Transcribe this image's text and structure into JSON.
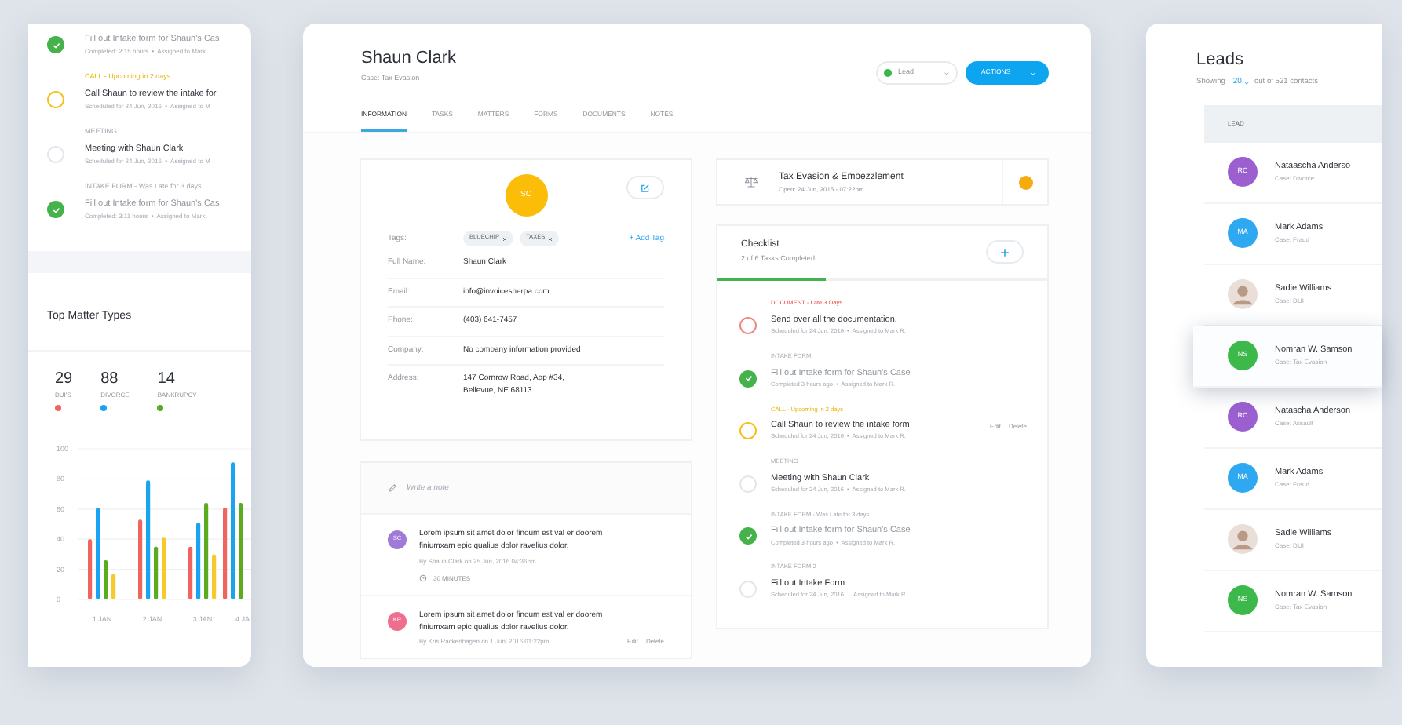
{
  "side_tasks": [
    {
      "checked": true,
      "title": "Fill out Intake form for Shaun's Cas",
      "meta": "Completed: 2:15 hours  •  Assigned to Mark"
    },
    {
      "kind": "upcoming",
      "checked": false,
      "label": "CALL - Upcoming in 2 days",
      "title": "Call Shaun to review the intake for",
      "meta": "Scheduled for 24 Jun, 2016  •  Assigned to M"
    },
    {
      "kind": "normal",
      "checked": false,
      "label": "MEETING",
      "title": "Meeting with Shaun Clark",
      "meta": "Scheduled for 24 Jun, 2016  •  Assigned to M"
    },
    {
      "kind": "normal",
      "checked": true,
      "label": "INTAKE FORM - Was Late for 3 days",
      "title": "Fill out Intake form for Shaun's Cas",
      "meta": "Completed: 3:11 hours  •  Assigned to Mark"
    }
  ],
  "top_matter_types": {
    "title": "Top Matter Types",
    "stats": [
      {
        "value": "29"
      },
      {
        "value": "88"
      },
      {
        "value": "14"
      }
    ],
    "chart_data": {
      "type": "bar",
      "categories": [
        "1 JAN",
        "2 JAN",
        "3 JAN",
        "4 JA"
      ],
      "ylim": [
        0,
        100
      ],
      "yticks": [
        0,
        20,
        40,
        60,
        80,
        100
      ],
      "grid": true,
      "series": [
        {
          "name": "DUI'S",
          "color": "#f0645f",
          "values": [
            40,
            53,
            35,
            61
          ]
        },
        {
          "name": "DIVORCE",
          "color": "#1aa3f0",
          "values": [
            61,
            79,
            51,
            91
          ]
        },
        {
          "name": "BANKRUPCY",
          "color": "#5aab1e",
          "values": [
            26,
            35,
            64,
            64
          ]
        },
        {
          "color": "#f8c92a",
          "values": [
            17,
            41,
            30,
            null
          ]
        }
      ]
    }
  },
  "contact": {
    "name": "Shaun Clark",
    "case": "Case: Tax Evasion",
    "status": {
      "label": "Lead",
      "color": "#3cb64a"
    },
    "actions_button": "ACTIONS"
  },
  "tabs": [
    {
      "label": "INFORMATION",
      "selected": true
    },
    {
      "label": "TASKS",
      "selected": false
    },
    {
      "label": "MATTERS",
      "selected": false
    },
    {
      "label": "FORMS",
      "selected": false
    },
    {
      "label": "DOCUMENTS",
      "selected": false
    },
    {
      "label": "NOTES",
      "selected": false
    }
  ],
  "profile": {
    "initials": "SC",
    "tags_label": "Tags:",
    "tags": [
      "BLUECHIP",
      "TAXES"
    ],
    "add_tag": "+ Add Tag",
    "fields": [
      {
        "label": "Full Name:",
        "value": "Shaun Clark"
      },
      {
        "label": "Email:",
        "value": "info@invoicesherpa.com"
      },
      {
        "label": "Phone:",
        "value": "(403) 641-7457"
      },
      {
        "label": "Company:",
        "value": "No company information provided"
      },
      {
        "label": "Address:",
        "value": "147 Cornrow Road, App #34,\nBellevue, NE 68113"
      }
    ]
  },
  "notes": {
    "placeholder": "Write a note",
    "items": [
      {
        "initials": "SC",
        "color": "#a07ad6",
        "text": "Lorem ipsum sit amet dolor finoum est val er doorem finiumxam epic qualius dolor ravelius dolor.",
        "byline": "By Shaun Clark on 25 Jun, 2016 04:36pm",
        "duration": "30 MINUTES"
      },
      {
        "initials": "KR",
        "color": "#ef6d8d",
        "text": "Lorem ipsum sit amet dolor finoum est val er doorem finiumxam epic qualius dolor ravelius dolor.",
        "byline": "By Kris Rackenhagen on 1 Jun, 2016 01:22pm",
        "actions": [
          "Edit",
          "Delete"
        ]
      }
    ]
  },
  "matter": {
    "title": "Tax Evasion & Embezzlement",
    "opened": "Open: 24 Jun, 2015 - 07:22pm",
    "flagged": true
  },
  "checklist": {
    "title": "Checklist",
    "summary": "2 of 6 Tasks Completed",
    "level": 0.33,
    "tasks": [
      {
        "kind": "late",
        "checked": false,
        "label": "DOCUMENT - Late 3 Days",
        "title": "Send over all the documentation.",
        "meta": "Scheduled for 24 Jun, 2016  •  Assigned to Mark R."
      },
      {
        "kind": "normal",
        "checked": true,
        "label": "INTAKE FORM",
        "title": "Fill out Intake form for Shaun's Case",
        "meta": "Completed 3 hours ago  •  Assigned to Mark R."
      },
      {
        "kind": "upcoming",
        "checked": false,
        "label": "CALL - Upcoming in 2 days",
        "title": "Call Shaun to review the intake form",
        "meta": "Scheduled for 24 Jun, 2016  •  Assigned to Mark R.",
        "actions": [
          "Edit",
          "Delete"
        ]
      },
      {
        "kind": "normal",
        "checked": false,
        "label": "MEETING",
        "title": "Meeting with Shaun Clark",
        "meta": "Scheduled for 24 Jun, 2016  •  Assigned to Mark R."
      },
      {
        "kind": "normal",
        "checked": true,
        "label": "INTAKE FORM - Was Late for 3 days",
        "title": "Fill out Intake form for Shaun's Case",
        "meta": "Completed 3 hours ago  •  Assigned to Mark R."
      },
      {
        "kind": "normal",
        "checked": false,
        "label": "INTAKE FORM 2",
        "title": "Fill out Intake Form",
        "meta": "Scheduled for 24 Jun, 2016      Assigned to Mark R."
      }
    ]
  },
  "leads": {
    "title": "Leads",
    "showing": "Showing",
    "page_size": "20",
    "total": "out of 521 contacts",
    "column": "LEAD",
    "rows": [
      {
        "kind": "initials",
        "initials": "RC",
        "color": "#9b5fd0",
        "name": "Nataascha Anderso",
        "case": "Case: Divorce",
        "selected": false
      },
      {
        "kind": "initials",
        "initials": "MA",
        "color": "#2ea8f0",
        "name": "Mark Adams",
        "case": "Case: Fraud",
        "selected": false
      },
      {
        "kind": "photo",
        "name": "Sadie Williams",
        "case": "Case: DUI",
        "selected": false
      },
      {
        "kind": "initials",
        "initials": "NS",
        "color": "#3db84a",
        "name": "Nomran W. Samson",
        "case": "Case: Tax Evasion",
        "selected": true
      },
      {
        "kind": "initials",
        "initials": "RC",
        "color": "#9b5fd0",
        "name": "Natascha Anderson",
        "case": "Case: Assault",
        "selected": false
      },
      {
        "kind": "initials",
        "initials": "MA",
        "color": "#2ea8f0",
        "name": "Mark Adams",
        "case": "Case: Fraud",
        "selected": false
      },
      {
        "kind": "photo",
        "name": "Sadie Williams",
        "case": "Case: DUI",
        "selected": false
      },
      {
        "kind": "initials",
        "initials": "NS",
        "color": "#3db84a",
        "name": "Nomran W. Samson",
        "case": "Case: Tax Evasion",
        "selected": false
      }
    ]
  }
}
